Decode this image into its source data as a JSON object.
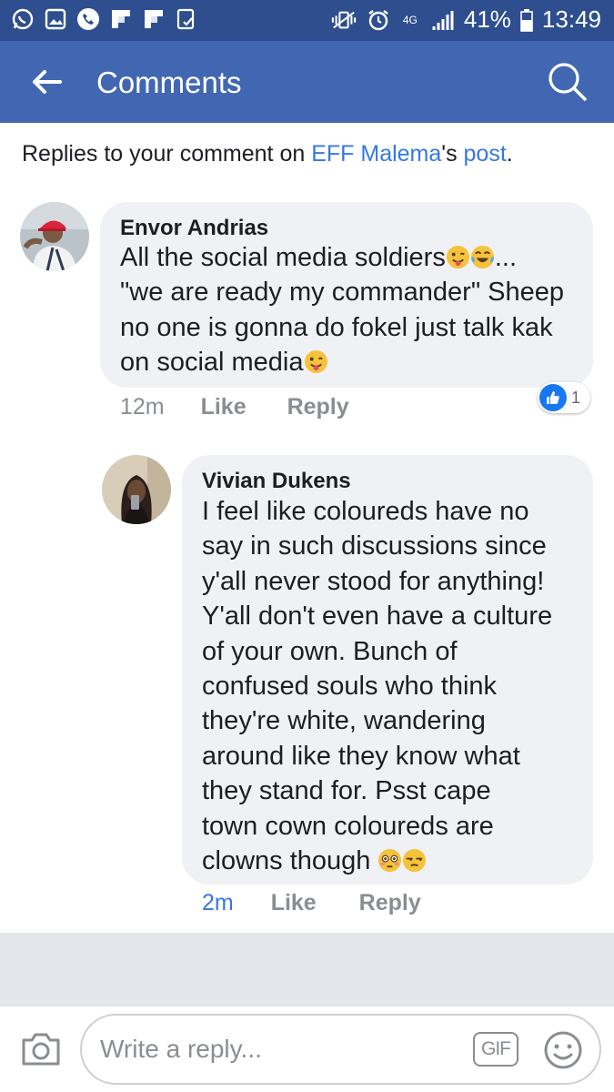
{
  "status_bar": {
    "network_label": "4G",
    "battery": "41%",
    "time": "13:49"
  },
  "app_bar": {
    "title": "Comments"
  },
  "context": {
    "prefix": "Replies to your comment on ",
    "page_name": "EFF Malema",
    "possessive": "'s ",
    "post_link": "post",
    "suffix": "."
  },
  "comments": [
    {
      "author": "Envor Andrias",
      "lines": [
        "All the social media soldiers",
        "\"we are ready my commander\" Sheep",
        "no one is gonna do fokel just talk kak",
        "on social media"
      ],
      "line1_suffix": "...",
      "time": "12m",
      "like_label": "Like",
      "reply_label": "Reply",
      "reaction_count": "1"
    },
    {
      "author": "Vivian Dukens",
      "lines": [
        "I feel like coloureds have no",
        "say in such discussions since",
        "y'all never stood for anything!",
        "Y'all don't even have a culture",
        "of your own. Bunch of",
        "confused souls who think",
        "they're white, wandering",
        "around like they know what",
        "they stand for.   Psst cape",
        "town cown coloureds are",
        "clowns though "
      ],
      "time": "2m",
      "like_label": "Like",
      "reply_label": "Reply"
    }
  ],
  "composer": {
    "placeholder": "Write a reply...",
    "gif_label": "GIF"
  },
  "colors": {
    "status_bar": "#2e4e8f",
    "app_bar": "#4267b2",
    "link": "#3578e5",
    "bubble": "#f0f1f4",
    "meta": "#8a8d91"
  },
  "icons": [
    "whatsapp-icon",
    "gallery-icon",
    "phone-icon",
    "flipboard-icon",
    "flipboard-icon",
    "checklist-icon",
    "vibrate-icon",
    "alarm-icon",
    "signal-icon",
    "battery-icon",
    "back-arrow-icon",
    "search-icon",
    "camera-icon",
    "sticker-icon"
  ]
}
